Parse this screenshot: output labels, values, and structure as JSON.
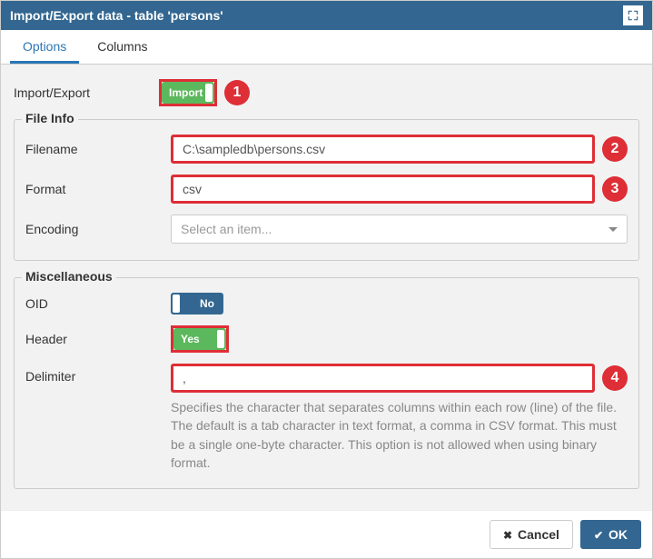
{
  "dialog": {
    "title": "Import/Export data - table 'persons'"
  },
  "tabs": {
    "options": "Options",
    "columns": "Columns"
  },
  "options": {
    "import_export_label": "Import/Export",
    "import_export_value": "Import",
    "file_info": {
      "legend": "File Info",
      "filename_label": "Filename",
      "filename_value": "C:\\sampledb\\persons.csv",
      "format_label": "Format",
      "format_value": "csv",
      "encoding_label": "Encoding",
      "encoding_placeholder": "Select an item..."
    },
    "misc": {
      "legend": "Miscellaneous",
      "oid_label": "OID",
      "oid_value": "No",
      "header_label": "Header",
      "header_value": "Yes",
      "delimiter_label": "Delimiter",
      "delimiter_value": ",",
      "delimiter_help": "Specifies the character that separates columns within each row (line) of the file. The default is a tab character in text format, a comma in CSV format. This must be a single one-byte character. This option is not allowed when using binary format."
    }
  },
  "badges": {
    "b1": "1",
    "b2": "2",
    "b3": "3",
    "b4": "4"
  },
  "footer": {
    "cancel": "Cancel",
    "ok": "OK"
  }
}
